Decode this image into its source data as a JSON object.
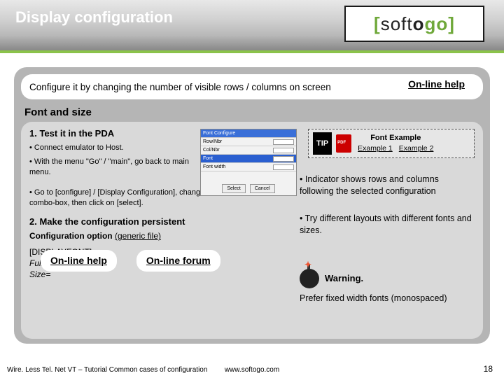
{
  "header": {
    "title": "Display configuration"
  },
  "logo": {
    "bracket_l": "[",
    "soft": "soft",
    "o": "o",
    "go": "go",
    "bracket_r": "]"
  },
  "banner": {
    "text": "Configure it by changing the number of visible rows / columns on screen",
    "help": "On-line help"
  },
  "section_label": "Font and size",
  "steps": {
    "s1_title": "1. Test it in the PDA",
    "b1": "• Connect emulator to Host.",
    "b2": "• With the menu \"Go\" / \"main\", go back to main menu.",
    "b3": "• Go to [configure] / [Display Configuration], change the value in the combo-box, then click on [select].",
    "s2_title": "2. Make the configuration persistent",
    "cfg_opt_a": "Configuration option",
    "cfg_opt_b": "(generic file)",
    "k_section": "[DISPLAYFONT]",
    "k_full": "Full. Name=",
    "k_size": "Size="
  },
  "tip": {
    "label": "TIP",
    "title": "Font Example",
    "ex1": "Example 1",
    "ex2": "Example 2"
  },
  "right": {
    "r1": "• Indicator shows rows and columns following the selected  configuration",
    "r2": "• Try different  layouts with different fonts and sizes.",
    "warn_h": "Warning.",
    "warn_b": "Prefer fixed width fonts (monospaced)"
  },
  "buttons": {
    "help": "On-line help",
    "forum": "On-line forum"
  },
  "mock": {
    "r1": "Font Configure",
    "r2": "Row/Nbr",
    "r3": "Col/Nbr",
    "r4": "Font",
    "r5": "Font width",
    "b1": "Select",
    "b2": "Cancel"
  },
  "footer": {
    "left": "Wire. Less Tel. Net VT – Tutorial Common cases of configuration",
    "center": "www.softogo.com",
    "page": "18"
  }
}
